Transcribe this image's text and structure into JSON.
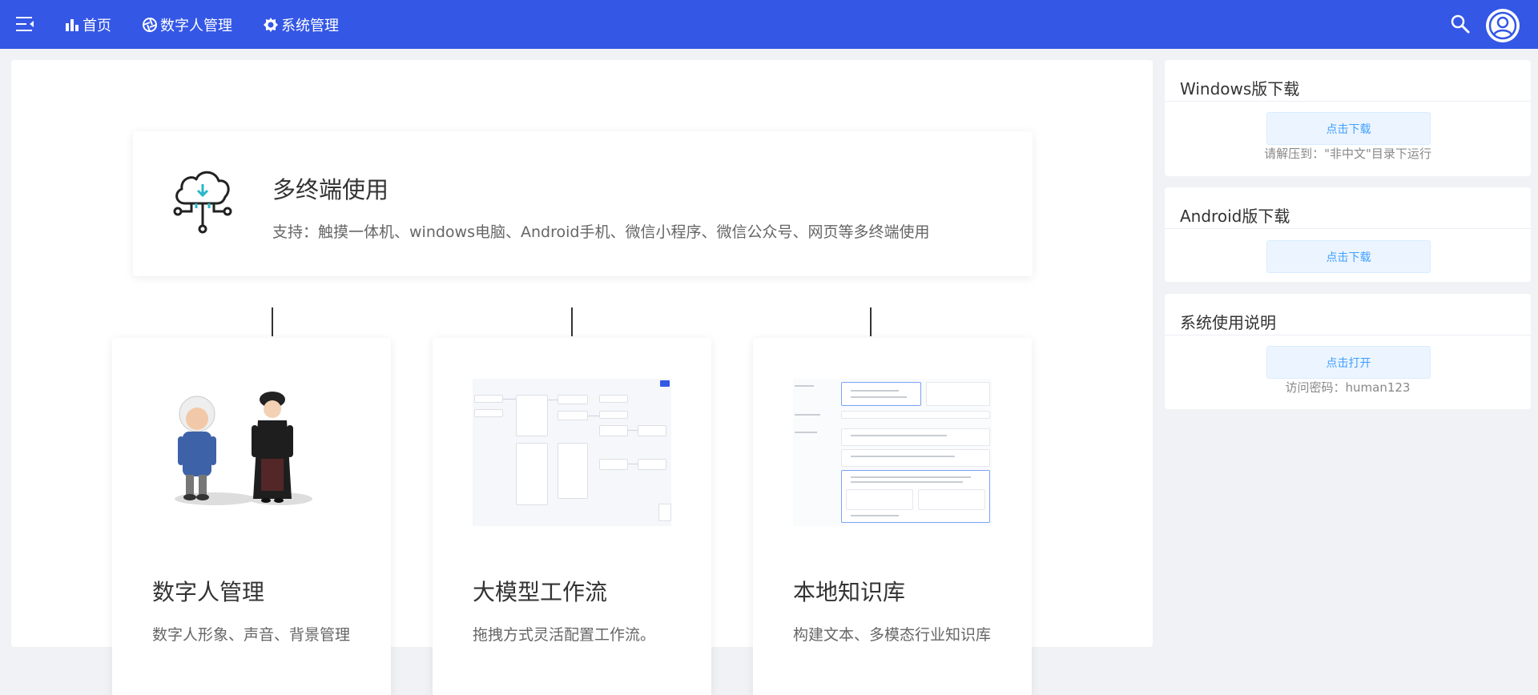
{
  "nav": {
    "items": [
      {
        "label": "首页",
        "icon": "bar-chart-icon"
      },
      {
        "label": "数字人管理",
        "icon": "aperture-icon"
      },
      {
        "label": "系统管理",
        "icon": "gear-icon"
      }
    ]
  },
  "hero": {
    "title": "多终端使用",
    "description": "支持：触摸一体机、windows电脑、Android手机、微信小程序、微信公众号、网页等多终端使用",
    "icon": "cloud-download-icon"
  },
  "cards": [
    {
      "title": "数字人管理",
      "description": "数字人形象、声音、背景管理"
    },
    {
      "title": "大模型工作流",
      "description": "拖拽方式灵活配置工作流。"
    },
    {
      "title": "本地知识库",
      "description": "构建文本、多模态行业知识库"
    }
  ],
  "side": {
    "windows": {
      "title": "Windows版下载",
      "button": "点击下载",
      "note": "请解压到：\"非中文\"目录下运行"
    },
    "android": {
      "title": "Android版下载",
      "button": "点击下载"
    },
    "manual": {
      "title": "系统使用说明",
      "button": "点击打开",
      "note": "访问密码：human123"
    }
  },
  "colors": {
    "topbar": "#3457e6",
    "accent": "#409eff",
    "page_bg": "#f0f2f5"
  }
}
